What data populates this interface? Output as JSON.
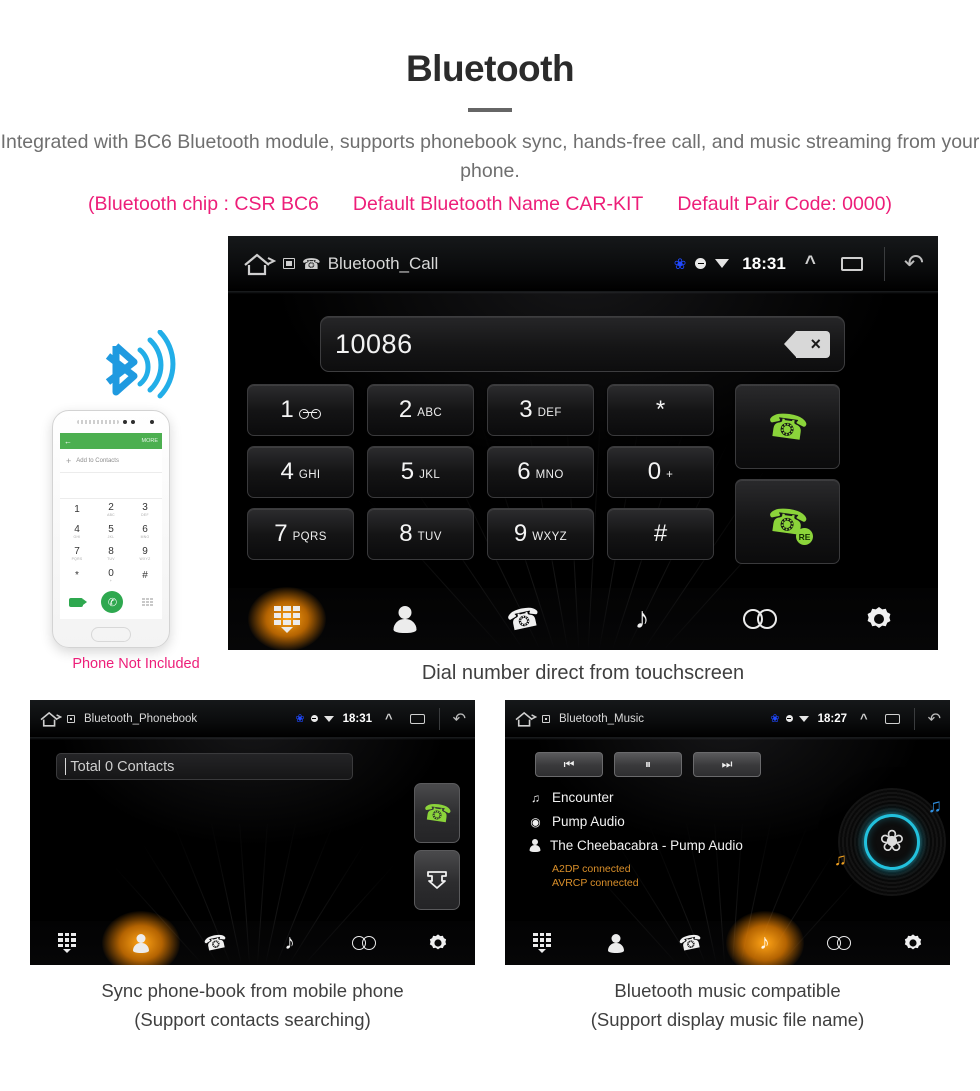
{
  "header": {
    "title": "Bluetooth",
    "subtitle": "Integrated with BC6 Bluetooth module, supports phonebook sync, hands-free call, and music streaming from your phone.",
    "specs": [
      "(Bluetooth chip : CSR BC6",
      "Default Bluetooth Name CAR-KIT",
      "Default Pair Code: 0000)"
    ],
    "accent_color": "#ed1e79"
  },
  "main_screen": {
    "status_bar": {
      "title": "Bluetooth_Call",
      "time": "18:31",
      "icons": [
        "home-icon",
        "sd-card-icon",
        "phone-hook-icon",
        "bluetooth-icon",
        "dnd-icon",
        "wifi-icon",
        "chevron-up-icon",
        "recents-icon",
        "back-icon"
      ]
    },
    "dial_input": {
      "value": "10086",
      "backspace_label": "×"
    },
    "keys": [
      {
        "num": "1",
        "sub": "",
        "voicemail": true
      },
      {
        "num": "2",
        "sub": "ABC"
      },
      {
        "num": "3",
        "sub": "DEF"
      },
      {
        "num": "*",
        "sub": ""
      },
      {
        "num": "4",
        "sub": "GHI"
      },
      {
        "num": "5",
        "sub": "JKL"
      },
      {
        "num": "6",
        "sub": "MNO"
      },
      {
        "num": "0",
        "sub": "+"
      },
      {
        "num": "7",
        "sub": "PQRS"
      },
      {
        "num": "8",
        "sub": "TUV"
      },
      {
        "num": "9",
        "sub": "WXYZ"
      },
      {
        "num": "#",
        "sub": ""
      }
    ],
    "call_button": {
      "icon": "call-handset-icon"
    },
    "redial_button": {
      "icon": "redial-handset-icon",
      "badge": "RE"
    },
    "nav": {
      "items": [
        "keypad",
        "contacts",
        "call-log",
        "music",
        "link",
        "settings"
      ],
      "active": "keypad"
    },
    "caption": "Dial number direct from touchscreen"
  },
  "phone_illustration": {
    "caption": "Phone Not Included",
    "screen": {
      "back_arrow": "←",
      "more_label": "MORE",
      "add_contact_label": "Add to Contacts",
      "add_plus": "+",
      "keys": [
        {
          "n": "1",
          "s": ""
        },
        {
          "n": "2",
          "s": "ABC"
        },
        {
          "n": "3",
          "s": "DEF"
        },
        {
          "n": "4",
          "s": "GHI"
        },
        {
          "n": "5",
          "s": "JKL"
        },
        {
          "n": "6",
          "s": "MNO"
        },
        {
          "n": "7",
          "s": "PQRS"
        },
        {
          "n": "8",
          "s": "TUV"
        },
        {
          "n": "9",
          "s": "WXYZ"
        },
        {
          "n": "*",
          "s": ""
        },
        {
          "n": "0",
          "s": "+"
        },
        {
          "n": "#",
          "s": ""
        }
      ],
      "call_glyph": "✆"
    }
  },
  "phonebook_screen": {
    "status_bar": {
      "title": "Bluetooth_Phonebook",
      "time": "18:31"
    },
    "search_placeholder": "Total 0 Contacts",
    "call_button": {
      "icon": "call-handset-icon"
    },
    "download_button": {
      "icon": "download-contacts-icon"
    },
    "nav": {
      "items": [
        "keypad",
        "contacts",
        "call-log",
        "music",
        "link",
        "settings"
      ],
      "active": "contacts"
    },
    "caption_line1": "Sync phone-book from mobile phone",
    "caption_line2": "(Support contacts searching)"
  },
  "music_screen": {
    "status_bar": {
      "title": "Bluetooth_Music",
      "time": "18:27"
    },
    "transport": {
      "prev": "⏮",
      "pause": "⏸",
      "next": "⏭"
    },
    "track": {
      "title": "Encounter",
      "album": "Pump Audio",
      "artist": "The Cheebacabra - Pump Audio",
      "status": [
        "A2DP connected",
        "AVRCP connected"
      ],
      "status_color": "#d98f2a"
    },
    "artwork": {
      "icon": "bluetooth-vinyl-icon",
      "ring_color": "#22c1dd"
    },
    "nav": {
      "items": [
        "keypad",
        "contacts",
        "call-log",
        "music",
        "link",
        "settings"
      ],
      "active": "music"
    },
    "caption_line1": "Bluetooth music compatible",
    "caption_line2": "(Support display music file name)"
  }
}
